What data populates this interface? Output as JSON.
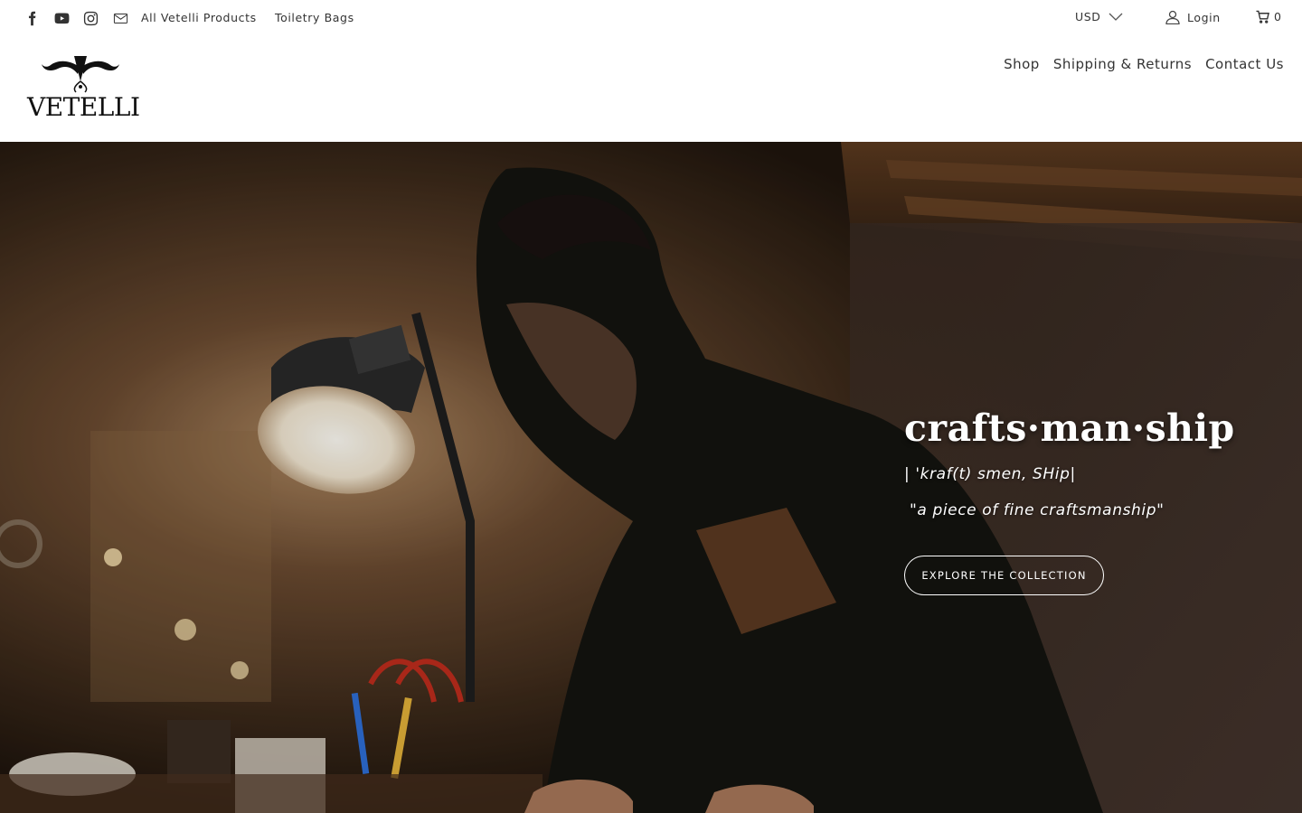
{
  "topbar": {
    "social_icons": [
      "facebook-icon",
      "youtube-icon",
      "instagram-icon",
      "mail-icon"
    ],
    "links": [
      "All Vetelli Products",
      "Toiletry Bags"
    ],
    "currency": "USD",
    "login_label": "Login",
    "cart_count": "0"
  },
  "header": {
    "logo_text": "VETELLI",
    "nav": [
      "Shop",
      "Shipping & Returns",
      "Contact Us"
    ]
  },
  "hero": {
    "title": "crafts·man·ship",
    "phonetic": "| 'kraf(t) smen, SHip|",
    "quote": "\"a piece of fine craftsmanship\"",
    "cta_label": "EXPLORE THE COLLECTION"
  },
  "colors": {
    "text": "#333333",
    "hero_overlay": "#2a1d14",
    "cta_border": "#ffffff"
  }
}
